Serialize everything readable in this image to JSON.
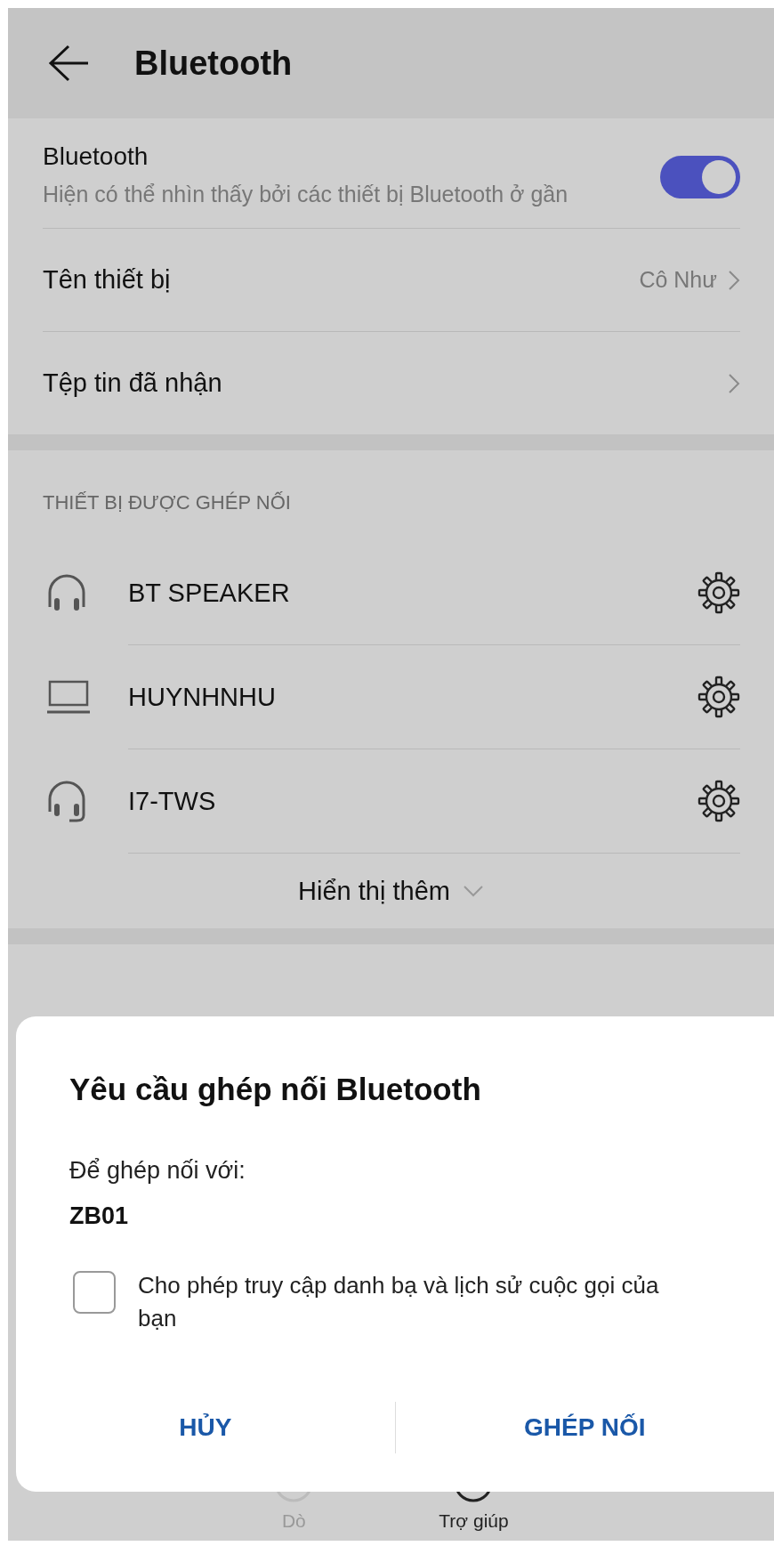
{
  "header": {
    "title": "Bluetooth"
  },
  "bluetooth": {
    "title": "Bluetooth",
    "subtitle": "Hiện có thể nhìn thấy bởi các thiết bị Bluetooth ở gần",
    "on": true
  },
  "settings": [
    {
      "label": "Tên thiết bị",
      "value": "Cô Như"
    },
    {
      "label": "Tệp tin đã nhận"
    }
  ],
  "paired": {
    "heading": "THIẾT BỊ ĐƯỢC GHÉP NỐI",
    "devices": [
      {
        "name": "BT SPEAKER",
        "kind": "headphones"
      },
      {
        "name": "HUYNHNHU",
        "kind": "laptop"
      },
      {
        "name": "I7-TWS",
        "kind": "headset"
      }
    ],
    "more": "Hiển thị thêm"
  },
  "bottom_nav": [
    {
      "label": "Dò",
      "disabled": true
    },
    {
      "label": "Trợ giúp",
      "disabled": false
    }
  ],
  "dialog": {
    "title": "Yêu cầu ghép nối Bluetooth",
    "prompt": "Để ghép nối với:",
    "device": "ZB01",
    "checkbox": {
      "label": "Cho phép truy cập danh bạ và lịch sử cuộc gọi của bạn",
      "checked": false
    },
    "buttons": [
      "HỦY",
      "GHÉP NỐI"
    ]
  }
}
